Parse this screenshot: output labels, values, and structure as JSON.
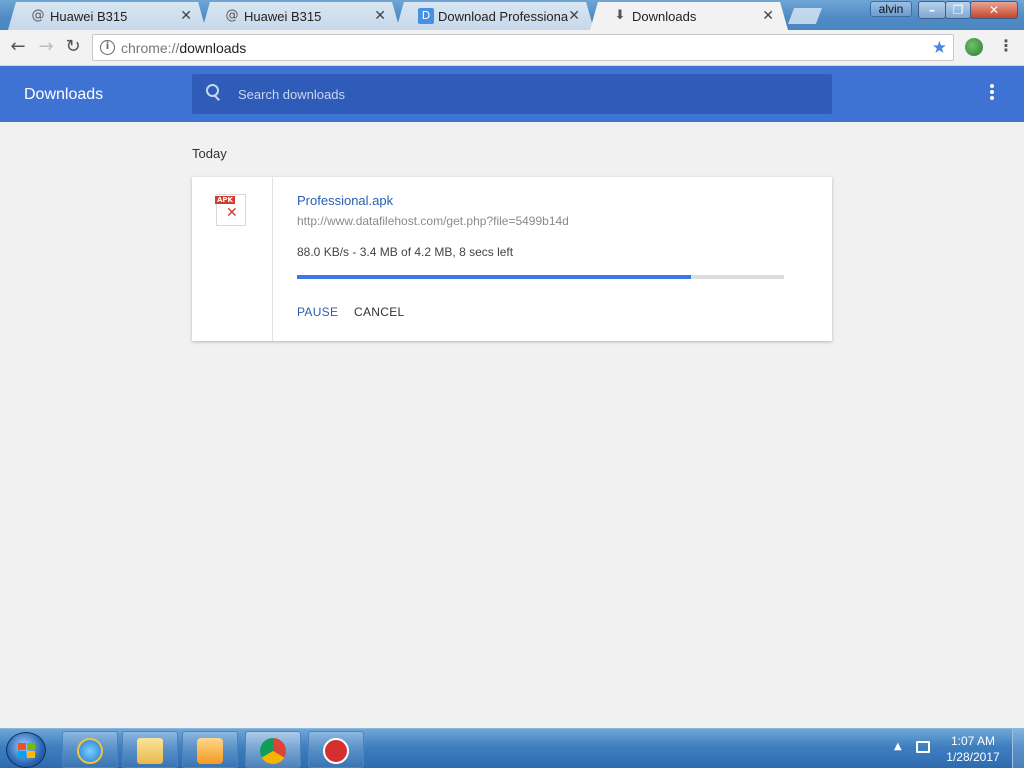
{
  "tabs": [
    {
      "title": "Huawei B315",
      "icon": "at-icon"
    },
    {
      "title": "Huawei B315",
      "icon": "at-icon"
    },
    {
      "title": "Download Professional.ap",
      "icon": "d-icon"
    },
    {
      "title": "Downloads",
      "icon": "download-icon",
      "active": true
    }
  ],
  "window": {
    "user": "alvin"
  },
  "address": {
    "scheme": "chrome://",
    "path": "downloads"
  },
  "page": {
    "title": "Downloads",
    "search_placeholder": "Search downloads",
    "date_header": "Today"
  },
  "download": {
    "file_name": "Professional.apk",
    "file_type_tag": "APK",
    "url": "http://www.datafilehost.com/get.php?file=5499b14d",
    "status": "88.0 KB/s - 3.4 MB of 4.2 MB, 8 secs left",
    "progress": 0.81,
    "pause_label": "PAUSE",
    "cancel_label": "CANCEL"
  },
  "taskbar": {
    "time": "1:07 AM",
    "date": "1/28/2017"
  },
  "colors": {
    "header": "#3e73d4",
    "search_bg": "#2f5cb8",
    "progress": "#3b78e7",
    "link": "#2a5db0"
  }
}
